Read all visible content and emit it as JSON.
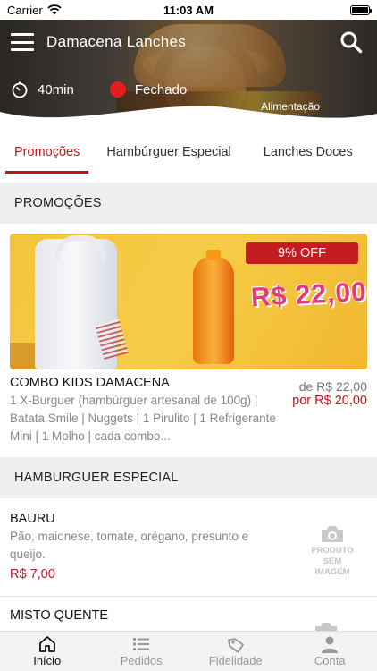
{
  "status_bar": {
    "carrier": "Carrier",
    "time": "11:03 AM"
  },
  "header": {
    "title": "Damacena Lanches",
    "delivery_time": "40min",
    "store_status": "Fechado",
    "category": "Alimentação"
  },
  "tabs": [
    {
      "label": "Promoções",
      "active": true
    },
    {
      "label": "Hambúrguer Especial",
      "active": false
    },
    {
      "label": "Lanches Doces",
      "active": false
    }
  ],
  "sections": {
    "promotions": {
      "title": "PROMOÇÕES",
      "items": [
        {
          "discount": "9% OFF",
          "banner_price": "R$ 22,00",
          "name": "COMBO KIDS DAMACENA",
          "description": "1 X-Burguer (hambúrguer artesanal de 100g) | Batata Smile | Nuggets | 1 Pirulito | 1 Refrigerante Mini | 1 Molho | cada combo...",
          "old_price": "de R$ 22,00",
          "new_price": "por R$ 20,00"
        }
      ]
    },
    "hamburguer_especial": {
      "title": "HAMBURGUER ESPECIAL",
      "items": [
        {
          "name": "BAURU",
          "description": "Pão, maionese, tomate, orégano, presunto e queijo.",
          "price": "R$ 7,00",
          "no_image_line1": "PRODUTO",
          "no_image_line2": "SEM IMAGEM"
        },
        {
          "name": "MISTO QUENTE"
        }
      ]
    }
  },
  "bottom_nav": [
    {
      "label": "Início",
      "icon": "home-icon",
      "active": true
    },
    {
      "label": "Pedidos",
      "icon": "list-icon",
      "active": false
    },
    {
      "label": "Fidelidade",
      "icon": "tag-icon",
      "active": false
    },
    {
      "label": "Conta",
      "icon": "person-icon",
      "active": false
    }
  ],
  "colors": {
    "accent": "#c0161c",
    "closed_dot": "#e01e1e",
    "section_bg": "#efefef"
  }
}
